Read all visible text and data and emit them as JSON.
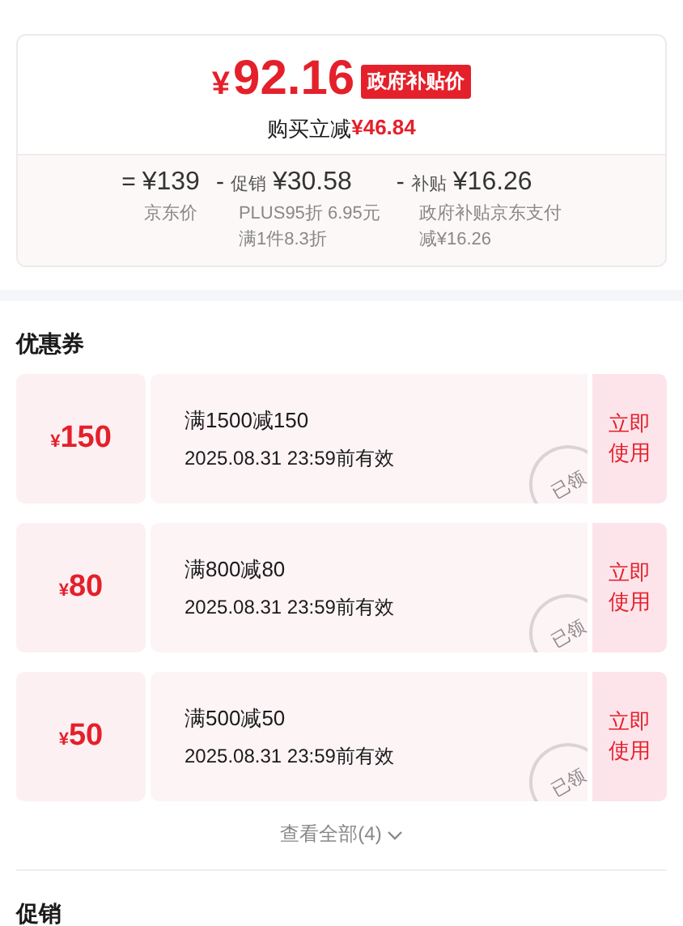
{
  "price_card": {
    "currency": "¥",
    "price": "92.16",
    "tag": "政府补贴价",
    "saving_label": "购买立减",
    "saving_amount": "¥46.84",
    "breakdown": [
      {
        "sign": "=",
        "amount": "¥139",
        "notes": [
          "京东价"
        ]
      },
      {
        "sign": "-",
        "label": "促销",
        "amount": "¥30.58",
        "notes": [
          "PLUS95折 6.95元",
          "满1件8.3折"
        ]
      },
      {
        "sign": "-",
        "label": "补贴",
        "amount": "¥16.26",
        "notes": [
          "政府补贴京东支付",
          "减¥16.26"
        ]
      }
    ]
  },
  "coupons_section": {
    "title": "优惠券",
    "coupons": [
      {
        "currency": "¥",
        "value": "150",
        "condition": "满1500减150",
        "validity": "2025.08.31 23:59前有效",
        "stamp": "已领",
        "action": "立即使用"
      },
      {
        "currency": "¥",
        "value": "80",
        "condition": "满800减80",
        "validity": "2025.08.31 23:59前有效",
        "stamp": "已领",
        "action": "立即使用"
      },
      {
        "currency": "¥",
        "value": "50",
        "condition": "满500减50",
        "validity": "2025.08.31 23:59前有效",
        "stamp": "已领",
        "action": "立即使用"
      }
    ],
    "view_all": "查看全部(4)"
  },
  "promotions_section": {
    "title": "促销"
  }
}
